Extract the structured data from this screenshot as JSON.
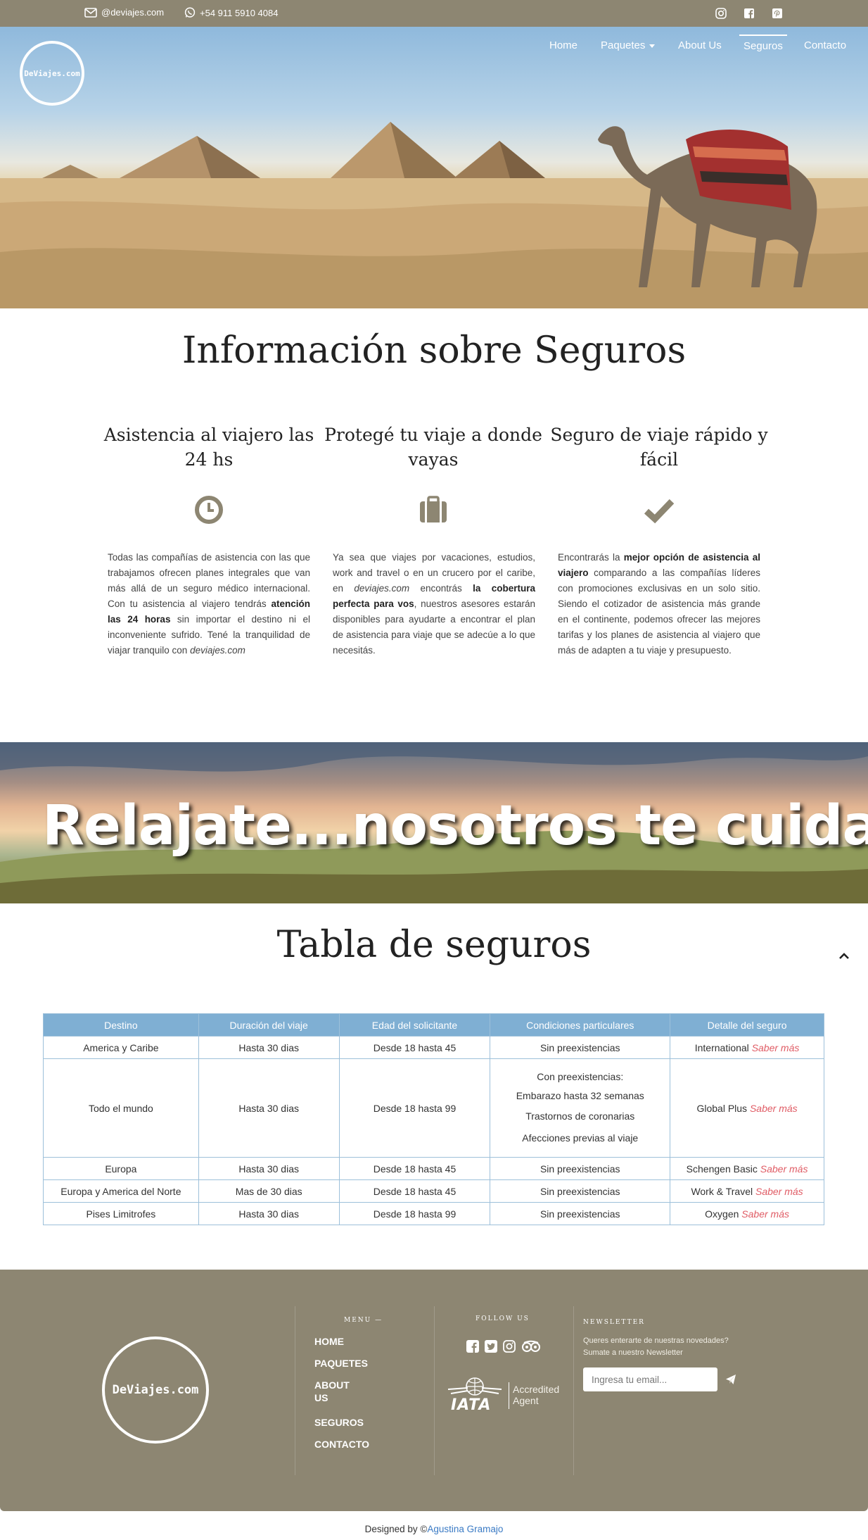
{
  "topbar": {
    "email": "@deviajes.com",
    "phone": "+54 911 5910 4084",
    "social_icons": [
      "instagram-icon",
      "facebook-icon",
      "pinterest-icon"
    ]
  },
  "header": {
    "logo_text": "DeViajes.com",
    "nav": [
      {
        "label": "Home"
      },
      {
        "label": "Paquetes"
      },
      {
        "label": "About Us"
      },
      {
        "label": "Seguros",
        "active": true
      },
      {
        "label": "Contacto"
      }
    ]
  },
  "info": {
    "title": "Información sobre Seguros",
    "columns": [
      {
        "title": "Asistencia al viajero las 24 hs",
        "icon": "clock-icon",
        "t1": "Todas las compañías de asistencia con las que trabajamos ofrecen planes integrales que van más allá de un seguro médico internacional. Con tu asistencia al viajero tendrás ",
        "b1": "atención las 24 horas",
        "t2": " sin importar el destino ni el inconveniente sufrido. Tené la tranquilidad de viajar tranquilo con ",
        "i1": "deviajes.com"
      },
      {
        "title": "Protegé tu viaje a donde vayas",
        "icon": "briefcase-icon",
        "t1": "Ya sea que viajes por vacaciones, estudios, work and travel o en un crucero por el caribe, en ",
        "i1": "deviajes.com",
        "t2": " encontrás ",
        "b1": "la cobertura perfecta para vos",
        "t3": ", nuestros asesores estarán disponibles para ayudarte a encontrar el plan de asistencia para viaje que se adecúe a lo que necesitás."
      },
      {
        "title": "Seguro de viaje rápido y fácil",
        "icon": "check-icon",
        "t1": "Encontrarás la ",
        "b1": "mejor opción de asistencia al viajero",
        "t2": " comparando a las compañías líderes con promociones exclusivas en un solo sitio. Siendo el cotizador de asistencia más grande en el continente, podemos ofrecer las mejores tarifas y los planes de asistencia al viajero que más de adapten a tu viaje y presupuesto."
      }
    ]
  },
  "banner": {
    "text": "Relajate...nosotros te cuidamos"
  },
  "insurance_table": {
    "title": "Tabla de seguros",
    "headers": [
      "Destino",
      "Duración del viaje",
      "Edad del solicitante",
      "Condiciones particulares",
      "Detalle del seguro"
    ],
    "link_label": "Saber más",
    "rows": [
      {
        "destino": "America y Caribe",
        "duracion": "Hasta 30 dias",
        "edad": "Desde 18 hasta 45",
        "condiciones": [
          "Sin preexistencias"
        ],
        "plan": "International"
      },
      {
        "destino": "Todo el mundo",
        "duracion": "Hasta 30 dias",
        "edad": "Desde 18 hasta 99",
        "condiciones": [
          "Con preexistencias:",
          "Embarazo hasta 32 semanas",
          "Trastornos de coronarias",
          "Afecciones previas al viaje"
        ],
        "plan": "Global Plus"
      },
      {
        "destino": "Europa",
        "duracion": "Hasta 30 dias",
        "edad": "Desde 18 hasta 45",
        "condiciones": [
          "Sin preexistencias"
        ],
        "plan": "Schengen Basic"
      },
      {
        "destino": "Europa y America del Norte",
        "duracion": "Mas de 30 dias",
        "edad": "Desde 18 hasta 45",
        "condiciones": [
          "Sin preexistencias"
        ],
        "plan": "Work & Travel"
      },
      {
        "destino": "Pises Limitrofes",
        "duracion": "Hasta 30 dias",
        "edad": "Desde 18 hasta 99",
        "condiciones": [
          "Sin preexistencias"
        ],
        "plan": "Oxygen"
      }
    ]
  },
  "footer": {
    "logo_text": "DeViajes.com",
    "menu_heading": "MENU —",
    "menu": [
      "HOME",
      "PAQUETES",
      "ABOUT",
      "US",
      "SEGUROS",
      "CONTACTO"
    ],
    "follow_heading": "FOLLOW US",
    "follow_icons": [
      "facebook-icon",
      "twitter-icon",
      "instagram-icon",
      "tripadvisor-icon"
    ],
    "iata_logo": "IATA",
    "iata_accredited": "Accredited",
    "iata_agent": "Agent",
    "newsletter_heading": "NEWSLETTER",
    "newsletter_line1": "Queres enterarte de nuestras novedades?",
    "newsletter_line2": "Sumate a nuestro Newsletter",
    "email_placeholder": "Ingresa tu email..."
  },
  "credits": {
    "prefix": "Designed by ©",
    "author": "Agustina Gramajo"
  },
  "colors": {
    "brand": "#8d8672",
    "table_header": "#7fafd3",
    "link": "#e05c65",
    "credit_link": "#3a7ac4"
  }
}
